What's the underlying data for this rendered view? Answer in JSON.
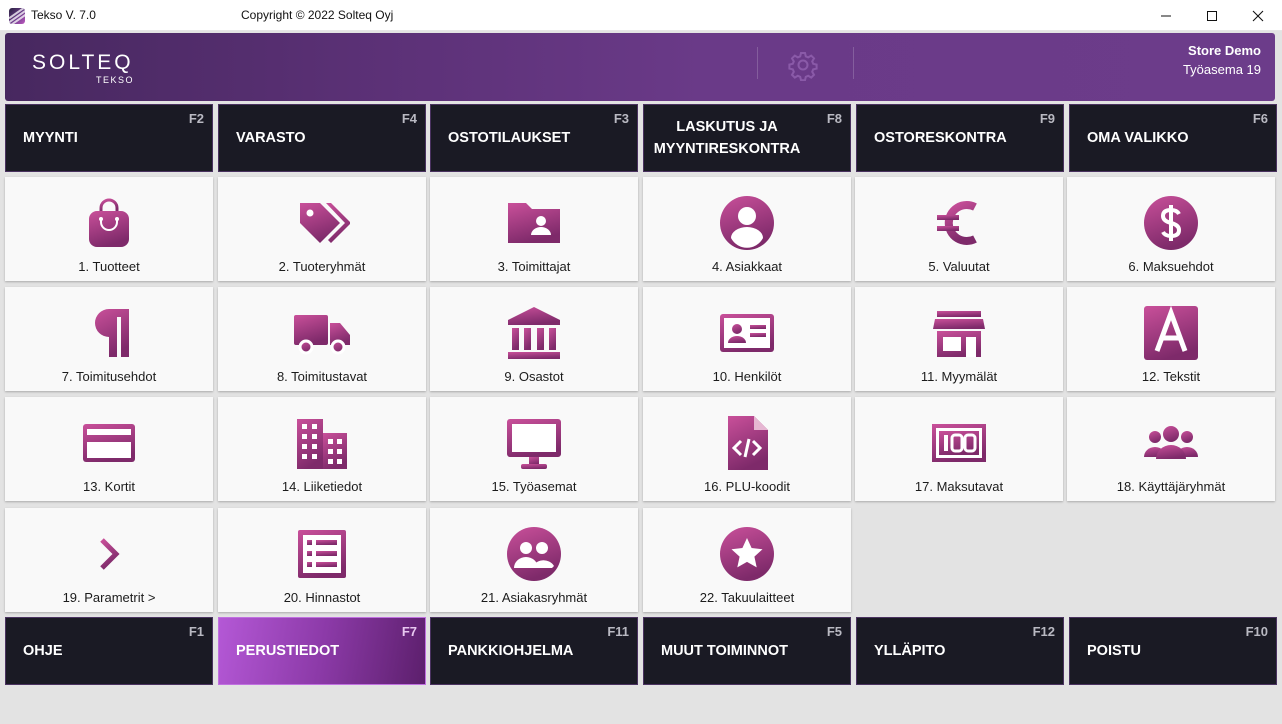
{
  "window": {
    "title": "Tekso V. 7.0",
    "copyright": "Copyright © 2022 Solteq Oyj"
  },
  "header": {
    "logo": "SOLTEQ",
    "logo_sub": "TEKSO",
    "store": "Store Demo",
    "workstation": "Työasema 19",
    "settings_icon": "gear-icon"
  },
  "colors": {
    "accent": "#b4407e",
    "header_bg": "#5c3177",
    "menu_bg": "#1a1a24",
    "active_menu": "#9a44b8"
  },
  "top_menu": [
    {
      "label": "MYYNTI",
      "key": "F2"
    },
    {
      "label": "VARASTO",
      "key": "F4"
    },
    {
      "label": "OSTOTILAUKSET",
      "key": "F3"
    },
    {
      "label": "LASKUTUS JA MYYNTIRESKONTRA",
      "key": "F8"
    },
    {
      "label": "OSTORESKONTRA",
      "key": "F9"
    },
    {
      "label": "OMA VALIKKO",
      "key": "F6"
    }
  ],
  "tiles": [
    {
      "label": "1. Tuotteet",
      "icon": "shopping-bag-icon"
    },
    {
      "label": "2. Tuoteryhmät",
      "icon": "tags-icon"
    },
    {
      "label": "3. Toimittajat",
      "icon": "folder-user-icon"
    },
    {
      "label": "4. Asiakkaat",
      "icon": "user-circle-icon"
    },
    {
      "label": "5. Valuutat",
      "icon": "euro-icon"
    },
    {
      "label": "6. Maksuehdot",
      "icon": "dollar-circle-icon"
    },
    {
      "label": "7. Toimitusehdot",
      "icon": "paragraph-icon"
    },
    {
      "label": "8. Toimitustavat",
      "icon": "truck-icon"
    },
    {
      "label": "9. Osastot",
      "icon": "bank-icon"
    },
    {
      "label": "10. Henkilöt",
      "icon": "id-card-icon"
    },
    {
      "label": "11. Myymälät",
      "icon": "store-icon"
    },
    {
      "label": "12. Tekstit",
      "icon": "letter-a-icon"
    },
    {
      "label": "13. Kortit",
      "icon": "credit-card-icon"
    },
    {
      "label": "14. Liiketiedot",
      "icon": "building-icon"
    },
    {
      "label": "15. Työasemat",
      "icon": "monitor-icon"
    },
    {
      "label": "16. PLU-koodit",
      "icon": "code-file-icon"
    },
    {
      "label": "17. Maksutavat",
      "icon": "banknote-100-icon"
    },
    {
      "label": "18. Käyttäjäryhmät",
      "icon": "users-group-icon"
    },
    {
      "label": "19. Parametrit >",
      "icon": "chevron-right-icon"
    },
    {
      "label": "20. Hinnastot",
      "icon": "list-icon"
    },
    {
      "label": "21. Asiakasryhmät",
      "icon": "users-circle-icon"
    },
    {
      "label": "22. Takuulaitteet",
      "icon": "star-circle-icon"
    }
  ],
  "bottom_menu": [
    {
      "label": "OHJE",
      "key": "F1"
    },
    {
      "label": "PERUSTIEDOT",
      "key": "F7",
      "active": true
    },
    {
      "label": "PANKKIOHJELMA",
      "key": "F11"
    },
    {
      "label": "MUUT TOIMINNOT",
      "key": "F5"
    },
    {
      "label": "YLLÄPITO",
      "key": "F12"
    },
    {
      "label": "POISTU",
      "key": "F10"
    }
  ]
}
